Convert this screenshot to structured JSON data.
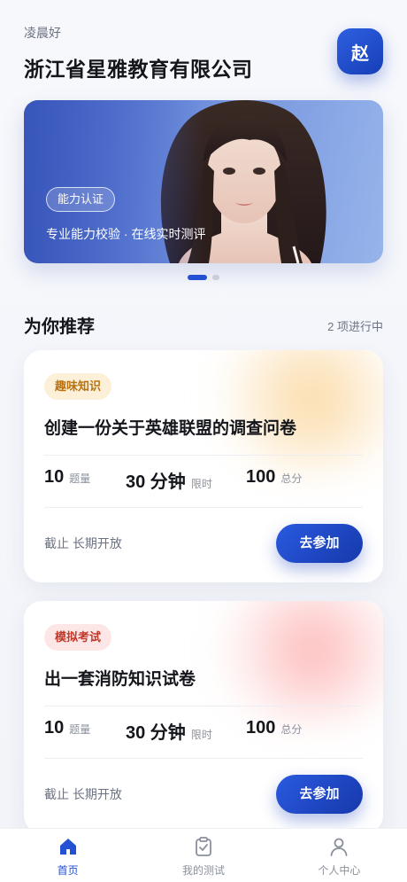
{
  "header": {
    "greeting": "凌晨好",
    "company": "浙江省星雅教育有限公司",
    "avatar_text": "赵"
  },
  "banner": {
    "tag": "能力认证",
    "caption": "专业能力校验 · 在线实时测评",
    "slides": 2,
    "active_slide": 1
  },
  "section": {
    "title": "为你推荐",
    "meta": "2 项进行中"
  },
  "cards": [
    {
      "tag": "趣味知识",
      "title": "创建一份关于英雄联盟的调查问卷",
      "questions": "10",
      "questions_unit": "题量",
      "duration": "30 分钟",
      "duration_unit": "限时",
      "score": "100",
      "score_unit": "总分",
      "deadline": "截止 长期开放",
      "button": "去参加",
      "accent": "#fad49a"
    },
    {
      "tag": "模拟考试",
      "title": "出一套消防知识试卷",
      "questions": "10",
      "questions_unit": "题量",
      "duration": "30 分钟",
      "duration_unit": "限时",
      "score": "100",
      "score_unit": "总分",
      "deadline": "截止 长期开放",
      "button": "去参加",
      "accent": "#fcb0b0"
    }
  ],
  "tabbar": {
    "items": [
      {
        "label": "首页",
        "icon": "home-icon",
        "active": true
      },
      {
        "label": "我的测试",
        "icon": "clipboard-icon",
        "active": false
      },
      {
        "label": "个人中心",
        "icon": "user-icon",
        "active": false
      }
    ]
  },
  "colors": {
    "primary": "#2451d4",
    "primary_dark": "#1638ab",
    "text": "#14161c",
    "muted": "#6b7280"
  }
}
